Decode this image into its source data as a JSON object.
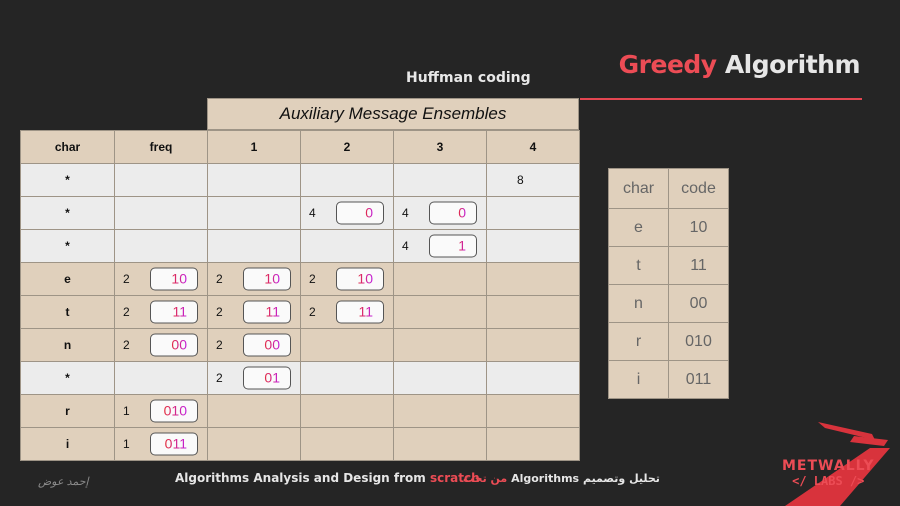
{
  "header": {
    "title_accent": "Greedy",
    "title_rest": "Algorithm",
    "subtitle": "Huffman coding",
    "ensembles_title": "Auxiliary Message Ensembles"
  },
  "main_table": {
    "columns": [
      "char",
      "freq",
      "1",
      "2",
      "3",
      "4"
    ],
    "rows": [
      {
        "char": "*",
        "tan": false,
        "cells": [
          null,
          null,
          null,
          null,
          {
            "freq": "8"
          }
        ]
      },
      {
        "char": "*",
        "tan": false,
        "cells": [
          null,
          null,
          {
            "freq": "4",
            "code": "0"
          },
          {
            "freq": "4",
            "code": "0"
          },
          null
        ]
      },
      {
        "char": "*",
        "tan": false,
        "cells": [
          null,
          null,
          null,
          {
            "freq": "4",
            "code": "1"
          },
          null
        ]
      },
      {
        "char": "e",
        "tan": true,
        "cells": [
          {
            "freq": "2",
            "code": "10"
          },
          {
            "freq": "2",
            "code": "10"
          },
          {
            "freq": "2",
            "code": "10"
          },
          null,
          null
        ]
      },
      {
        "char": "t",
        "tan": true,
        "cells": [
          {
            "freq": "2",
            "code": "11"
          },
          {
            "freq": "2",
            "code": "11"
          },
          {
            "freq": "2",
            "code": "11"
          },
          null,
          null
        ]
      },
      {
        "char": "n",
        "tan": true,
        "cells": [
          {
            "freq": "2",
            "code": "00"
          },
          {
            "freq": "2",
            "code": "00"
          },
          null,
          null,
          null
        ]
      },
      {
        "char": "*",
        "tan": false,
        "cells": [
          null,
          {
            "freq": "2",
            "code": "01"
          },
          null,
          null,
          null
        ]
      },
      {
        "char": "r",
        "tan": true,
        "cells": [
          {
            "freq": "1",
            "code": "010"
          },
          null,
          null,
          null,
          null
        ]
      },
      {
        "char": "i",
        "tan": true,
        "cells": [
          {
            "freq": "1",
            "code": "011"
          },
          null,
          null,
          null,
          null
        ]
      }
    ]
  },
  "code_table": {
    "headers": [
      "char",
      "code"
    ],
    "rows": [
      {
        "char": "e",
        "code": "10"
      },
      {
        "char": "t",
        "code": "11"
      },
      {
        "char": "n",
        "code": "00"
      },
      {
        "char": "r",
        "code": "010"
      },
      {
        "char": "i",
        "code": "011"
      }
    ]
  },
  "footer": {
    "course_prefix": "Algorithms Analysis and Design from",
    "course_accent": "scratch",
    "arabic_accent": "من تحت",
    "arabic_rest": "تحليل وتصميم Algorithms",
    "signature": "إحمد عوض",
    "logo_line1": "METWALLY",
    "logo_line2": "</ LABS />"
  },
  "colors": {
    "background": "#252525",
    "accent": "#ec4c55",
    "tan": "#e0d0bc",
    "light_row": "#ececec"
  }
}
